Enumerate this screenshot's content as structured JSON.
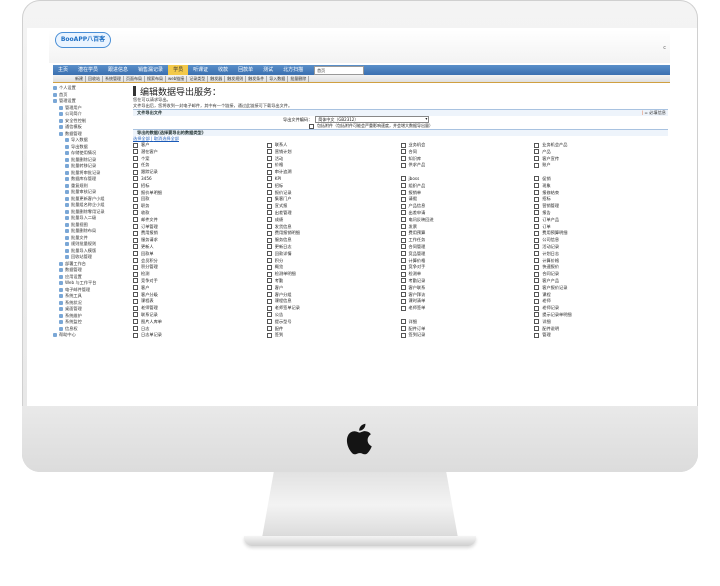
{
  "app": {
    "logo_text": "BooAPP八百客",
    "corner_text": "c"
  },
  "nav": {
    "items": [
      "主页",
      "潜在学员",
      "跟进信息",
      "销售漏记录",
      "学员",
      "听课证",
      "收款",
      "回款单",
      "测试",
      "北方扫描"
    ],
    "active_index": 4,
    "select_value": "首页"
  },
  "subnav": {
    "items": [
      "新建",
      "回收站",
      "系统管理",
      "页面布局",
      "搜索布局",
      "web链接",
      "记录类型",
      "触发器",
      "触发规则",
      "触发条件",
      "导入数据",
      "批量删除"
    ]
  },
  "sidebar": {
    "items": [
      {
        "label": "个人设置",
        "level": 0
      },
      {
        "label": "首页",
        "level": 0
      },
      {
        "label": "管理设置",
        "level": 0
      },
      {
        "label": "管理用户",
        "level": 1
      },
      {
        "label": "公司简介",
        "level": 1
      },
      {
        "label": "安全性控制",
        "level": 1
      },
      {
        "label": "通信模板",
        "level": 1
      },
      {
        "label": "数据管理",
        "level": 1
      },
      {
        "label": "导入数据",
        "level": 2
      },
      {
        "label": "导出数据",
        "level": 2
      },
      {
        "label": "存储使用情况",
        "level": 2
      },
      {
        "label": "批量删除记录",
        "level": 2
      },
      {
        "label": "批量转移记录",
        "level": 2
      },
      {
        "label": "批量将审批记录",
        "level": 2
      },
      {
        "label": "数据库存管理",
        "level": 2
      },
      {
        "label": "重复规则",
        "level": 2
      },
      {
        "label": "批量审核记录",
        "level": 2
      },
      {
        "label": "批量更新客户小组",
        "level": 2
      },
      {
        "label": "批量组名称企小组",
        "level": 2
      },
      {
        "label": "批量删除零用记录",
        "level": 2
      },
      {
        "label": "批量导入二级",
        "level": 2
      },
      {
        "label": "批量视图",
        "level": 2
      },
      {
        "label": "批量删除布局",
        "level": 2
      },
      {
        "label": "批量文件",
        "level": 2
      },
      {
        "label": "规则批量规则",
        "level": 2
      },
      {
        "label": "批量导入模版",
        "level": 2
      },
      {
        "label": "回收站管理",
        "level": 2
      },
      {
        "label": "部署工作台",
        "level": 1
      },
      {
        "label": "数据管理",
        "level": 1
      },
      {
        "label": "应用设置",
        "level": 1
      },
      {
        "label": "Web 与工作平台",
        "level": 1
      },
      {
        "label": "电子邮件管理",
        "level": 1
      },
      {
        "label": "系统工具",
        "level": 1
      },
      {
        "label": "系统状况",
        "level": 1
      },
      {
        "label": "桌面管理",
        "level": 1
      },
      {
        "label": "系统维护",
        "level": 1
      },
      {
        "label": "系统监控",
        "level": 1
      },
      {
        "label": "信息权",
        "level": 1
      },
      {
        "label": "帮助中心",
        "level": 0
      }
    ]
  },
  "main": {
    "title": "编辑数据导出服务：",
    "hint1": "您在可以请求导出。",
    "hint2": "文件导出后，您将收到一封电子邮件，其中有一个链接，通过此链接可下载导出文件。",
    "section1": "文件导出文件",
    "required_label": "= 必填信息",
    "file_label": "导出文件编码：",
    "file_value": "简体中文（GB2312）",
    "include_label": "包括附件（包括附件可能会严重影响速度，并会增大数据导出量）",
    "section2": "导出的数据(选择要导出的数据类型)",
    "select_all": "选择全部",
    "deselect_all": "取消选择全部",
    "items": [
      "客户",
      "联系人",
      "业务机会",
      "业务机会产品",
      "潜在客户",
      "营销计划",
      "合同",
      "产品",
      "个案",
      "活动",
      "知识库",
      "客户宣传",
      "任务",
      "价格",
      "供求产品",
      "账户",
      "跟踪记录",
      "审计追溯",
      "",
      "",
      "3456",
      "KPI",
      "jboss",
      "促销",
      "招标",
      "招标",
      "组织产品",
      "现象",
      "报价单明细",
      "报价记录",
      "报销单",
      "报修结束",
      "回款",
      "集客门户",
      "请假",
      "招标",
      "职务",
      "宣式报",
      "产品信息",
      "营销管理",
      "收款",
      "出差管理",
      "出差申请",
      "报告",
      "邮件文件",
      "成绩",
      "电讯反映回进",
      "订单产品",
      "订单管理",
      "发货信息",
      "发票",
      "订单",
      "费用报销",
      "费用报销明细",
      "费用预算",
      "费用预算明细",
      "服务请求",
      "服务信息",
      "工作任务",
      "公司信息",
      "更新人",
      "更新日志",
      "合同管理",
      "活动记录",
      "回款单",
      "回款详情",
      "竞品管理",
      "计划日志",
      "会员积分",
      "积分",
      "计算价格",
      "计算价格",
      "积分管理",
      "概览",
      "竞争对手",
      "快速报价",
      "检测",
      "检测单明细",
      "检测单",
      "合同记录",
      "竞争对手",
      "考勤",
      "考勤记录",
      "客户产品",
      "客户",
      "客户",
      "客户联系",
      "客户报价记录",
      "客户分级",
      "客户分组",
      "客户拜访",
      "课程",
      "课程表",
      "课程信息",
      "课时清单",
      "老师",
      "老师管理",
      "老师签单记录",
      "老师签单",
      "老师记录",
      "联系记录",
      "公告",
      "",
      "提示记录单明细",
      "图片人库单",
      "提示型号",
      "详细",
      "详细",
      "日志",
      "配件",
      "配件订单",
      "配件说明",
      "日志单记录",
      "签到",
      "签到记录",
      "管理"
    ]
  }
}
